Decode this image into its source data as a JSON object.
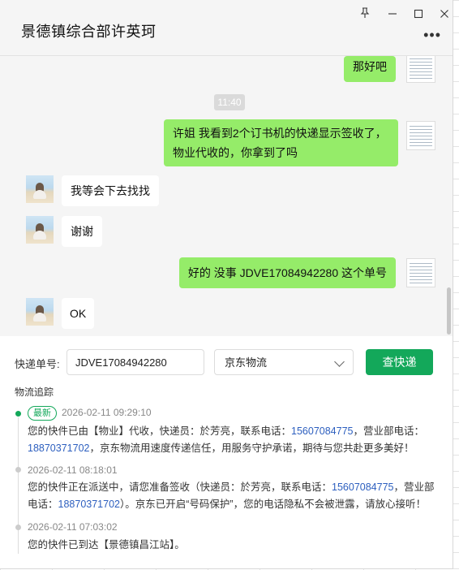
{
  "window": {
    "title": "景德镇综合部许英珂",
    "pin_icon": "pin-icon",
    "minimize_icon": "minimize-icon",
    "maximize_icon": "maximize-icon",
    "close_icon": "close-icon",
    "more_icon": "more-icon"
  },
  "chat": {
    "messages": [
      {
        "from": "me",
        "text": "那好吧"
      },
      {
        "from": "time",
        "text": "11:40"
      },
      {
        "from": "me",
        "text": "许姐  我看到2个订书机的快递显示签收了，物业代收的，你拿到了吗"
      },
      {
        "from": "other",
        "text": "我等会下去找找"
      },
      {
        "from": "other",
        "text": "谢谢"
      },
      {
        "from": "me",
        "text": "好的 没事  JDVE17084942280  这个单号"
      },
      {
        "from": "other",
        "text": "OK"
      }
    ]
  },
  "tracker": {
    "tracking_label": "快递单号:",
    "tracking_value": "JDVE17084942280",
    "carrier_selected": "京东物流",
    "search_button": "查快递",
    "section_title": "物流追踪",
    "events": [
      {
        "badge": "最新",
        "time": "2026-02-11 09:29:10",
        "text_a": "您的快件已由【物业】代收，快递员：於芳亮，联系电话：",
        "phone_a": "15607084775",
        "text_b": "，营业部电话：",
        "phone_b": "18870371702",
        "text_c": "，京东物流用速度传递信任，用服务守护承诺，期待与您共赴更多美好！"
      },
      {
        "time": "2026-02-11 08:18:01",
        "text_a": "您的快件正在派送中，请您准备签收（快递员：於芳亮，联系电话：",
        "phone_a": "15607084775",
        "text_b": "，营业部电话：",
        "phone_b": "18870371702",
        "text_c": "）。京东已开启“号码保护”，您的电话隐私不会被泄露，请放心接听！"
      },
      {
        "time": "2026-02-11 07:03:02",
        "text_a": "您的快件已到达【景德镇昌江站】。"
      }
    ]
  },
  "colors": {
    "my_bubble": "#95ec69",
    "accent_green": "#13a85a",
    "phone_link": "#2d5fbf"
  }
}
